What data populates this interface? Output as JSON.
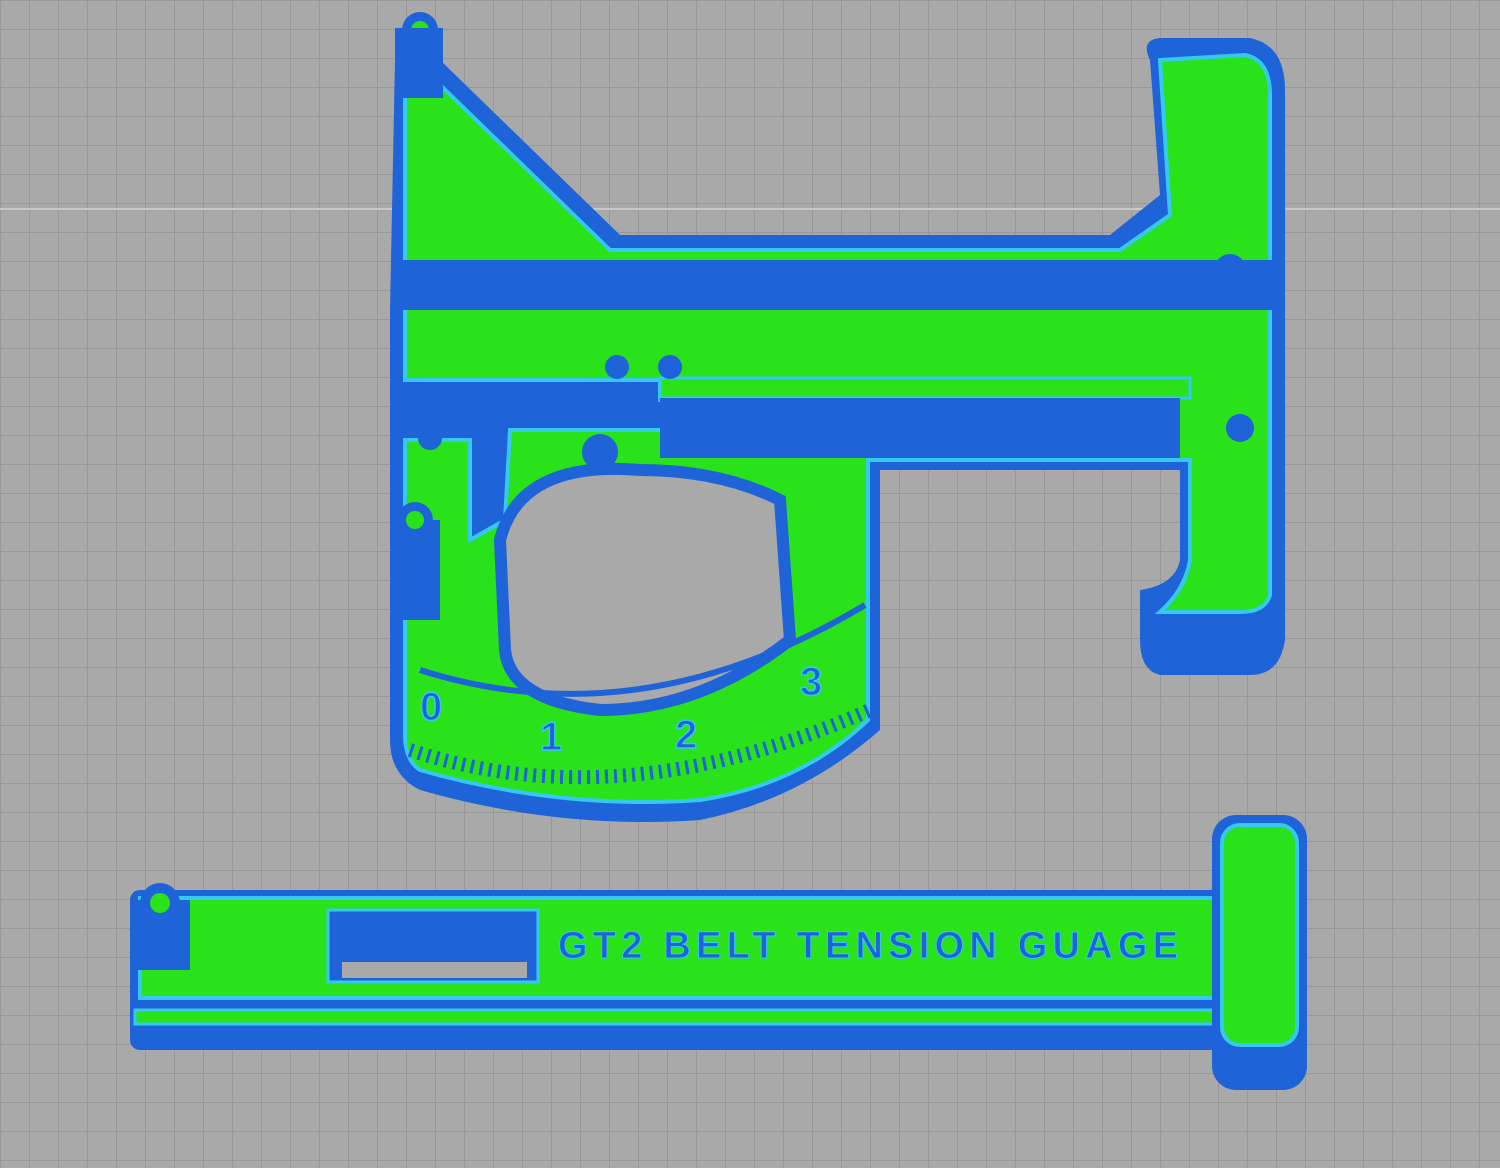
{
  "viewport": {
    "label_text": "GT2 BELT TENSION GUAGE",
    "dial_numbers": [
      "0",
      "1",
      "2",
      "3"
    ]
  },
  "colors": {
    "bed": "#a9a9a9",
    "perimeter": "#1f63d9",
    "outline": "#35c8f0",
    "infill": "#29e21a"
  }
}
